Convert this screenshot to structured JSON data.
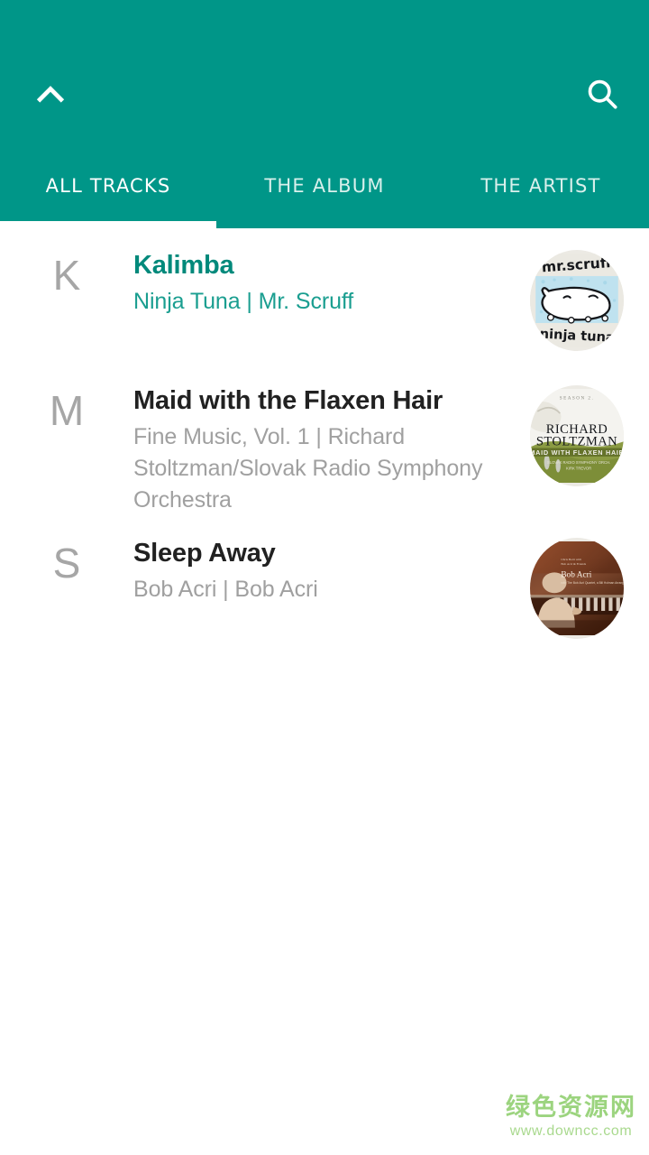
{
  "theme": {
    "primary": "#009688",
    "primary_text": "#00897b",
    "title_color": "#212121",
    "subtitle_color": "#a0a0a0",
    "index_letter_color": "#a6a6a6",
    "background": "#ffffff",
    "tab_text": "#ffffff"
  },
  "header": {
    "collapse_icon": "chevron-up-icon",
    "search_icon": "search-icon",
    "tabs": [
      {
        "label": "ALL TRACKS",
        "active": true
      },
      {
        "label": "THE ALBUM",
        "active": false
      },
      {
        "label": "THE ARTIST",
        "active": false
      }
    ],
    "active_tab_index": 0
  },
  "track_list": {
    "tracks": [
      {
        "index_letter": "K",
        "title": "Kalimba",
        "subtitle": "Ninja Tuna | Mr. Scruff",
        "album": "Ninja Tuna",
        "artist": "Mr. Scruff",
        "playing": true,
        "artwork": "ninja-tuna-cover"
      },
      {
        "index_letter": "M",
        "title": "Maid with the Flaxen Hair",
        "subtitle": "Fine Music, Vol. 1 | Richard Stoltzman/Slovak Radio Symphony Orchestra",
        "album": "Fine Music, Vol. 1",
        "artist": "Richard Stoltzman/Slovak Radio Symphony Orchestra",
        "playing": false,
        "artwork": "richard-stoltzman-cover"
      },
      {
        "index_letter": "S",
        "title": "Sleep Away",
        "subtitle": "Bob Acri | Bob Acri",
        "album": "Bob Acri",
        "artist": "Bob Acri",
        "playing": false,
        "artwork": "bob-acri-cover"
      }
    ]
  },
  "watermark": {
    "site_name": "绿色资源网",
    "url": "www.downcc.com"
  }
}
